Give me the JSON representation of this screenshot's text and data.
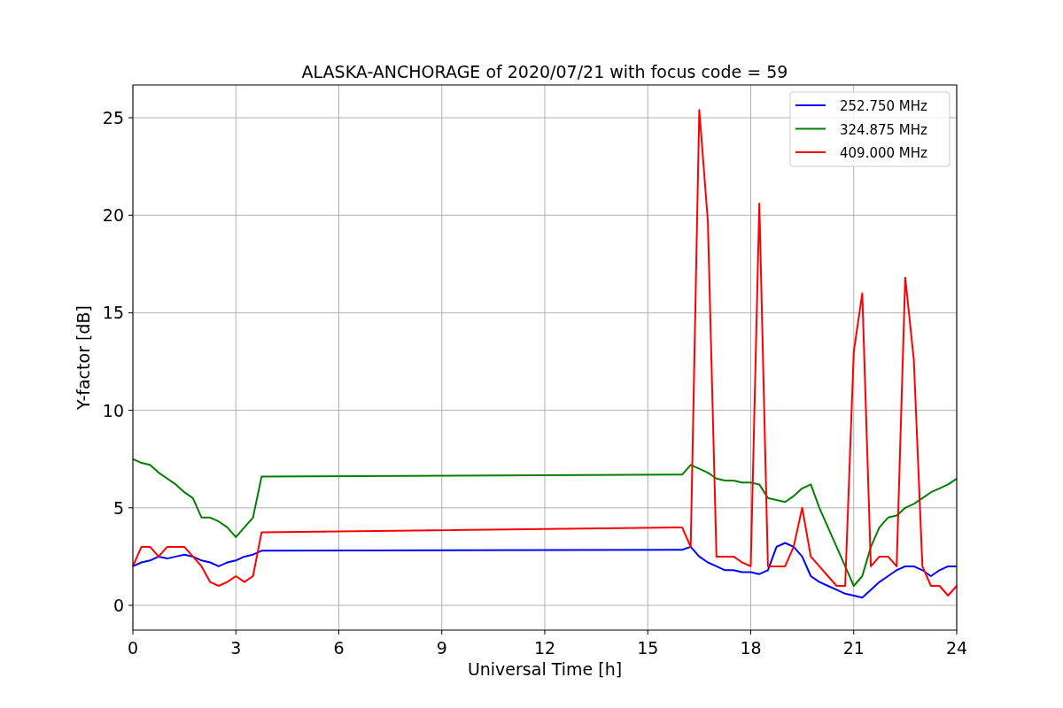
{
  "figure": {
    "chart_data": {
      "type": "line",
      "title": "ALASKA-ANCHORAGE of 2020/07/21 with focus code = 59",
      "xlabel": "Universal Time [h]",
      "ylabel": "Y-factor [dB]",
      "x": [
        0,
        0.25,
        0.5,
        0.75,
        1,
        1.25,
        1.5,
        1.75,
        2,
        2.25,
        2.5,
        2.75,
        3,
        3.25,
        3.5,
        3.75,
        16,
        16.25,
        16.5,
        16.75,
        17,
        17.25,
        17.5,
        17.75,
        18,
        18.25,
        18.5,
        18.75,
        19,
        19.25,
        19.5,
        19.75,
        20,
        20.25,
        20.5,
        20.75,
        21,
        21.25,
        21.5,
        21.75,
        22,
        22.25,
        22.5,
        22.75,
        23,
        23.25,
        23.5,
        23.75,
        24
      ],
      "series": [
        {
          "name": "252.750 MHz",
          "color": "#0000ff",
          "values": [
            2,
            2.2,
            2.3,
            2.5,
            2.4,
            2.5,
            2.6,
            2.5,
            2.3,
            2.2,
            2,
            2.2,
            2.3,
            2.5,
            2.6,
            2.8,
            2.85,
            3,
            2.5,
            2.2,
            2,
            1.8,
            1.8,
            1.7,
            1.7,
            1.6,
            1.8,
            3,
            3.2,
            3,
            2.5,
            1.5,
            1.2,
            1,
            0.8,
            0.6,
            0.5,
            0.4,
            0.8,
            1.2,
            1.5,
            1.8,
            2,
            2,
            1.8,
            1.5,
            1.8,
            2,
            2
          ]
        },
        {
          "name": "324.875 MHz",
          "color": "#008000",
          "values": [
            7.5,
            7.3,
            7.2,
            6.8,
            6.5,
            6.2,
            5.8,
            5.5,
            4.5,
            4.5,
            4.3,
            4,
            3.5,
            4,
            4.5,
            6.6,
            6.7,
            7.2,
            7,
            6.8,
            6.5,
            6.4,
            6.4,
            6.3,
            6.3,
            6.2,
            5.5,
            5.4,
            5.3,
            5.6,
            6,
            6.2,
            5,
            4,
            3,
            2,
            1,
            1.5,
            3,
            4,
            4.5,
            4.6,
            5,
            5.2,
            5.5,
            5.8,
            6,
            6.2,
            6.5
          ]
        },
        {
          "name": "409.000 MHz",
          "color": "#ff0000",
          "values": [
            2,
            3,
            3,
            2.5,
            3,
            3,
            3,
            2.5,
            2,
            1.2,
            1,
            1.2,
            1.5,
            1.2,
            1.5,
            3.75,
            4,
            3,
            25.4,
            19.7,
            2.5,
            2.5,
            2.5,
            2.2,
            2,
            20.6,
            2,
            2,
            2,
            3,
            5,
            2.5,
            2,
            1.5,
            1,
            1,
            13,
            16,
            2,
            2.5,
            2.5,
            2,
            16.8,
            12.6,
            2,
            1,
            1,
            0.5,
            1
          ]
        }
      ],
      "grid": true,
      "legend": true,
      "xlim": [
        0,
        24
      ],
      "ylim": [
        -1.27,
        26.68
      ],
      "xticks": [
        0,
        3,
        6,
        9,
        12,
        15,
        18,
        21,
        24
      ],
      "yticks": [
        0,
        5,
        10,
        15,
        20,
        25
      ]
    }
  }
}
